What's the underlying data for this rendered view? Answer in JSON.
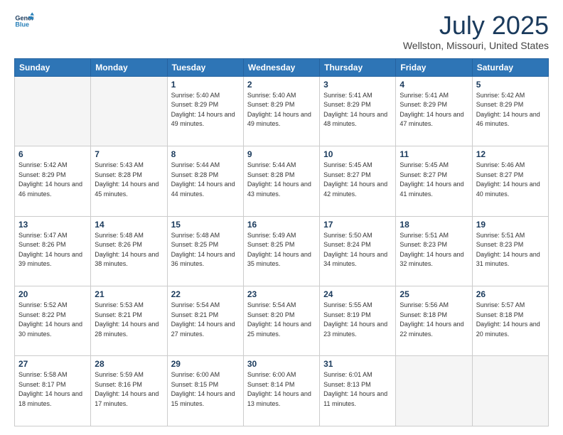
{
  "header": {
    "logo_line1": "General",
    "logo_line2": "Blue",
    "title": "July 2025",
    "subtitle": "Wellston, Missouri, United States"
  },
  "weekdays": [
    "Sunday",
    "Monday",
    "Tuesday",
    "Wednesday",
    "Thursday",
    "Friday",
    "Saturday"
  ],
  "weeks": [
    [
      {
        "day": "",
        "sunrise": "",
        "sunset": "",
        "daylight": ""
      },
      {
        "day": "",
        "sunrise": "",
        "sunset": "",
        "daylight": ""
      },
      {
        "day": "1",
        "sunrise": "Sunrise: 5:40 AM",
        "sunset": "Sunset: 8:29 PM",
        "daylight": "Daylight: 14 hours and 49 minutes."
      },
      {
        "day": "2",
        "sunrise": "Sunrise: 5:40 AM",
        "sunset": "Sunset: 8:29 PM",
        "daylight": "Daylight: 14 hours and 49 minutes."
      },
      {
        "day": "3",
        "sunrise": "Sunrise: 5:41 AM",
        "sunset": "Sunset: 8:29 PM",
        "daylight": "Daylight: 14 hours and 48 minutes."
      },
      {
        "day": "4",
        "sunrise": "Sunrise: 5:41 AM",
        "sunset": "Sunset: 8:29 PM",
        "daylight": "Daylight: 14 hours and 47 minutes."
      },
      {
        "day": "5",
        "sunrise": "Sunrise: 5:42 AM",
        "sunset": "Sunset: 8:29 PM",
        "daylight": "Daylight: 14 hours and 46 minutes."
      }
    ],
    [
      {
        "day": "6",
        "sunrise": "Sunrise: 5:42 AM",
        "sunset": "Sunset: 8:29 PM",
        "daylight": "Daylight: 14 hours and 46 minutes."
      },
      {
        "day": "7",
        "sunrise": "Sunrise: 5:43 AM",
        "sunset": "Sunset: 8:28 PM",
        "daylight": "Daylight: 14 hours and 45 minutes."
      },
      {
        "day": "8",
        "sunrise": "Sunrise: 5:44 AM",
        "sunset": "Sunset: 8:28 PM",
        "daylight": "Daylight: 14 hours and 44 minutes."
      },
      {
        "day": "9",
        "sunrise": "Sunrise: 5:44 AM",
        "sunset": "Sunset: 8:28 PM",
        "daylight": "Daylight: 14 hours and 43 minutes."
      },
      {
        "day": "10",
        "sunrise": "Sunrise: 5:45 AM",
        "sunset": "Sunset: 8:27 PM",
        "daylight": "Daylight: 14 hours and 42 minutes."
      },
      {
        "day": "11",
        "sunrise": "Sunrise: 5:45 AM",
        "sunset": "Sunset: 8:27 PM",
        "daylight": "Daylight: 14 hours and 41 minutes."
      },
      {
        "day": "12",
        "sunrise": "Sunrise: 5:46 AM",
        "sunset": "Sunset: 8:27 PM",
        "daylight": "Daylight: 14 hours and 40 minutes."
      }
    ],
    [
      {
        "day": "13",
        "sunrise": "Sunrise: 5:47 AM",
        "sunset": "Sunset: 8:26 PM",
        "daylight": "Daylight: 14 hours and 39 minutes."
      },
      {
        "day": "14",
        "sunrise": "Sunrise: 5:48 AM",
        "sunset": "Sunset: 8:26 PM",
        "daylight": "Daylight: 14 hours and 38 minutes."
      },
      {
        "day": "15",
        "sunrise": "Sunrise: 5:48 AM",
        "sunset": "Sunset: 8:25 PM",
        "daylight": "Daylight: 14 hours and 36 minutes."
      },
      {
        "day": "16",
        "sunrise": "Sunrise: 5:49 AM",
        "sunset": "Sunset: 8:25 PM",
        "daylight": "Daylight: 14 hours and 35 minutes."
      },
      {
        "day": "17",
        "sunrise": "Sunrise: 5:50 AM",
        "sunset": "Sunset: 8:24 PM",
        "daylight": "Daylight: 14 hours and 34 minutes."
      },
      {
        "day": "18",
        "sunrise": "Sunrise: 5:51 AM",
        "sunset": "Sunset: 8:23 PM",
        "daylight": "Daylight: 14 hours and 32 minutes."
      },
      {
        "day": "19",
        "sunrise": "Sunrise: 5:51 AM",
        "sunset": "Sunset: 8:23 PM",
        "daylight": "Daylight: 14 hours and 31 minutes."
      }
    ],
    [
      {
        "day": "20",
        "sunrise": "Sunrise: 5:52 AM",
        "sunset": "Sunset: 8:22 PM",
        "daylight": "Daylight: 14 hours and 30 minutes."
      },
      {
        "day": "21",
        "sunrise": "Sunrise: 5:53 AM",
        "sunset": "Sunset: 8:21 PM",
        "daylight": "Daylight: 14 hours and 28 minutes."
      },
      {
        "day": "22",
        "sunrise": "Sunrise: 5:54 AM",
        "sunset": "Sunset: 8:21 PM",
        "daylight": "Daylight: 14 hours and 27 minutes."
      },
      {
        "day": "23",
        "sunrise": "Sunrise: 5:54 AM",
        "sunset": "Sunset: 8:20 PM",
        "daylight": "Daylight: 14 hours and 25 minutes."
      },
      {
        "day": "24",
        "sunrise": "Sunrise: 5:55 AM",
        "sunset": "Sunset: 8:19 PM",
        "daylight": "Daylight: 14 hours and 23 minutes."
      },
      {
        "day": "25",
        "sunrise": "Sunrise: 5:56 AM",
        "sunset": "Sunset: 8:18 PM",
        "daylight": "Daylight: 14 hours and 22 minutes."
      },
      {
        "day": "26",
        "sunrise": "Sunrise: 5:57 AM",
        "sunset": "Sunset: 8:18 PM",
        "daylight": "Daylight: 14 hours and 20 minutes."
      }
    ],
    [
      {
        "day": "27",
        "sunrise": "Sunrise: 5:58 AM",
        "sunset": "Sunset: 8:17 PM",
        "daylight": "Daylight: 14 hours and 18 minutes."
      },
      {
        "day": "28",
        "sunrise": "Sunrise: 5:59 AM",
        "sunset": "Sunset: 8:16 PM",
        "daylight": "Daylight: 14 hours and 17 minutes."
      },
      {
        "day": "29",
        "sunrise": "Sunrise: 6:00 AM",
        "sunset": "Sunset: 8:15 PM",
        "daylight": "Daylight: 14 hours and 15 minutes."
      },
      {
        "day": "30",
        "sunrise": "Sunrise: 6:00 AM",
        "sunset": "Sunset: 8:14 PM",
        "daylight": "Daylight: 14 hours and 13 minutes."
      },
      {
        "day": "31",
        "sunrise": "Sunrise: 6:01 AM",
        "sunset": "Sunset: 8:13 PM",
        "daylight": "Daylight: 14 hours and 11 minutes."
      },
      {
        "day": "",
        "sunrise": "",
        "sunset": "",
        "daylight": ""
      },
      {
        "day": "",
        "sunrise": "",
        "sunset": "",
        "daylight": ""
      }
    ]
  ]
}
